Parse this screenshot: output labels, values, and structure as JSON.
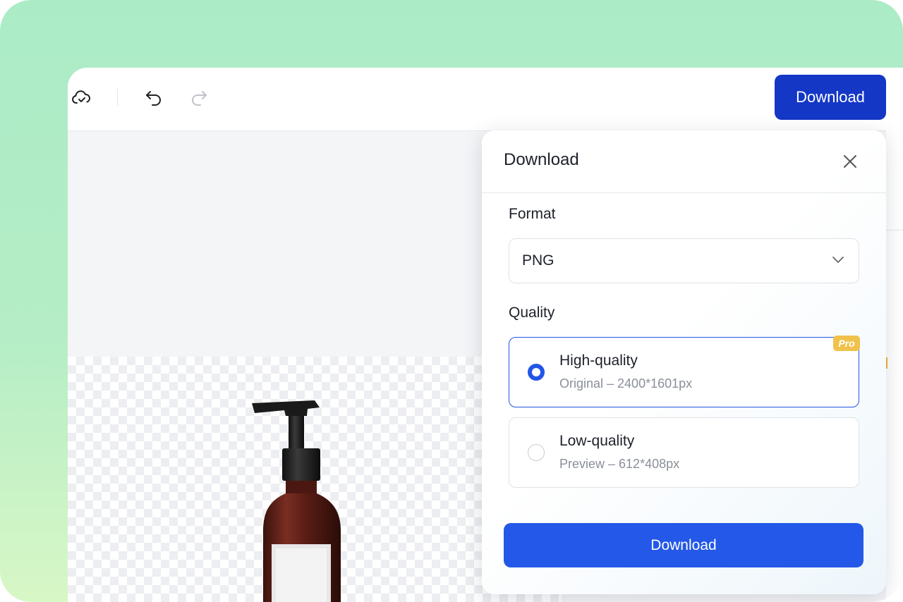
{
  "toolbar": {
    "cloud_icon": "cloud-check-icon",
    "undo_icon": "undo-icon",
    "redo_icon": "redo-icon",
    "download_label": "Download"
  },
  "dialog": {
    "title": "Download",
    "close_icon": "close-icon",
    "format": {
      "label": "Format",
      "selected": "PNG"
    },
    "quality": {
      "label": "Quality",
      "options": [
        {
          "title": "High-quality",
          "subtitle": "Original – 2400*1601px",
          "selected": true,
          "badge": "Pro"
        },
        {
          "title": "Low-quality",
          "subtitle": "Preview – 612*408px",
          "selected": false
        }
      ]
    },
    "download_label": "Download"
  },
  "colors": {
    "primary": "#2358e8",
    "toolbar_button": "#1437c6",
    "pro_badge": "#f0c24b",
    "frame_green": "#abecc7"
  }
}
